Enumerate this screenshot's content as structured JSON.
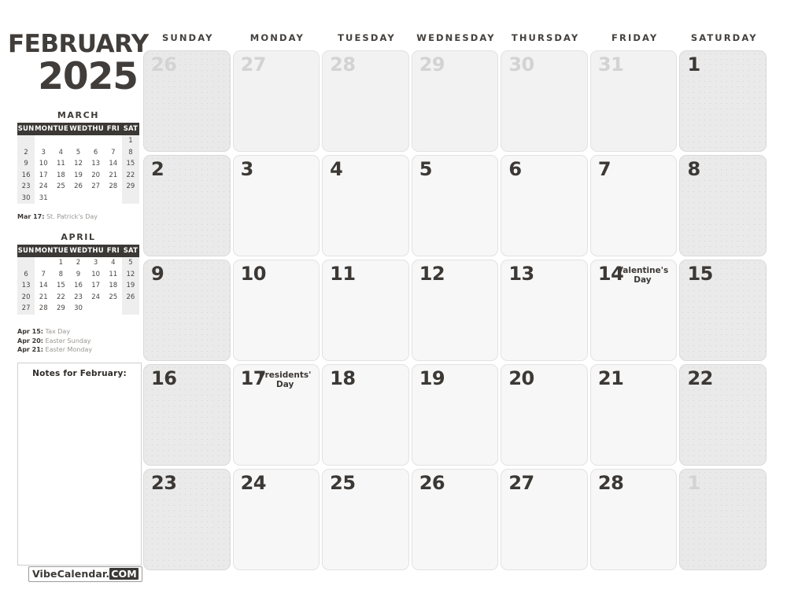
{
  "header": {
    "month": "FEBRUARY",
    "year": "2025"
  },
  "brand": {
    "name": "VibeCalendar.",
    "tld": "COM"
  },
  "notes": {
    "title": "Notes for February:",
    "value": ""
  },
  "weekday_headers": [
    "SUNDAY",
    "MONDAY",
    "TUESDAY",
    "WEDNESDAY",
    "THURSDAY",
    "FRIDAY",
    "SATURDAY"
  ],
  "mini_calendars": [
    {
      "name": "MARCH",
      "dow": [
        "SUN",
        "MON",
        "TUE",
        "WED",
        "THU",
        "FRI",
        "SAT"
      ],
      "weeks": [
        [
          "",
          "",
          "",
          "",
          "",
          "",
          "1"
        ],
        [
          "2",
          "3",
          "4",
          "5",
          "6",
          "7",
          "8"
        ],
        [
          "9",
          "10",
          "11",
          "12",
          "13",
          "14",
          "15"
        ],
        [
          "16",
          "17",
          "18",
          "19",
          "20",
          "21",
          "22"
        ],
        [
          "23",
          "24",
          "25",
          "26",
          "27",
          "28",
          "29"
        ],
        [
          "30",
          "31",
          "",
          "",
          "",
          "",
          ""
        ]
      ],
      "holidays": [
        {
          "date": "Mar 17:",
          "label": "St. Patrick's Day"
        }
      ]
    },
    {
      "name": "APRIL",
      "dow": [
        "SUN",
        "MON",
        "TUE",
        "WED",
        "THU",
        "FRI",
        "SAT"
      ],
      "weeks": [
        [
          "",
          "",
          "1",
          "2",
          "3",
          "4",
          "5"
        ],
        [
          "6",
          "7",
          "8",
          "9",
          "10",
          "11",
          "12"
        ],
        [
          "13",
          "14",
          "15",
          "16",
          "17",
          "18",
          "19"
        ],
        [
          "20",
          "21",
          "22",
          "23",
          "24",
          "25",
          "26"
        ],
        [
          "27",
          "28",
          "29",
          "30",
          "",
          "",
          ""
        ]
      ],
      "holidays": [
        {
          "date": "Apr 15:",
          "label": "Tax Day"
        },
        {
          "date": "Apr 20:",
          "label": "Easter Sunday"
        },
        {
          "date": "Apr 21:",
          "label": "Easter Monday"
        }
      ]
    }
  ],
  "weeks": [
    [
      {
        "day": "26",
        "current": false,
        "event": ""
      },
      {
        "day": "27",
        "current": false,
        "event": ""
      },
      {
        "day": "28",
        "current": false,
        "event": ""
      },
      {
        "day": "29",
        "current": false,
        "event": ""
      },
      {
        "day": "30",
        "current": false,
        "event": ""
      },
      {
        "day": "31",
        "current": false,
        "event": ""
      },
      {
        "day": "1",
        "current": true,
        "event": ""
      }
    ],
    [
      {
        "day": "2",
        "current": true,
        "event": ""
      },
      {
        "day": "3",
        "current": true,
        "event": ""
      },
      {
        "day": "4",
        "current": true,
        "event": ""
      },
      {
        "day": "5",
        "current": true,
        "event": ""
      },
      {
        "day": "6",
        "current": true,
        "event": ""
      },
      {
        "day": "7",
        "current": true,
        "event": ""
      },
      {
        "day": "8",
        "current": true,
        "event": ""
      }
    ],
    [
      {
        "day": "9",
        "current": true,
        "event": ""
      },
      {
        "day": "10",
        "current": true,
        "event": ""
      },
      {
        "day": "11",
        "current": true,
        "event": ""
      },
      {
        "day": "12",
        "current": true,
        "event": ""
      },
      {
        "day": "13",
        "current": true,
        "event": ""
      },
      {
        "day": "14",
        "current": true,
        "event": "Valentine's Day"
      },
      {
        "day": "15",
        "current": true,
        "event": ""
      }
    ],
    [
      {
        "day": "16",
        "current": true,
        "event": ""
      },
      {
        "day": "17",
        "current": true,
        "event": "Presidents' Day"
      },
      {
        "day": "18",
        "current": true,
        "event": ""
      },
      {
        "day": "19",
        "current": true,
        "event": ""
      },
      {
        "day": "20",
        "current": true,
        "event": ""
      },
      {
        "day": "21",
        "current": true,
        "event": ""
      },
      {
        "day": "22",
        "current": true,
        "event": ""
      }
    ],
    [
      {
        "day": "23",
        "current": true,
        "event": ""
      },
      {
        "day": "24",
        "current": true,
        "event": ""
      },
      {
        "day": "25",
        "current": true,
        "event": ""
      },
      {
        "day": "26",
        "current": true,
        "event": ""
      },
      {
        "day": "27",
        "current": true,
        "event": ""
      },
      {
        "day": "28",
        "current": true,
        "event": ""
      },
      {
        "day": "1",
        "current": false,
        "event": ""
      }
    ]
  ],
  "colors": {
    "ink": "#3b3835",
    "muted": "#9a9793",
    "weekend_cell": "#eaeaea",
    "weekday_cell": "#f7f7f7",
    "other_month_text": "#d3d3d3"
  }
}
